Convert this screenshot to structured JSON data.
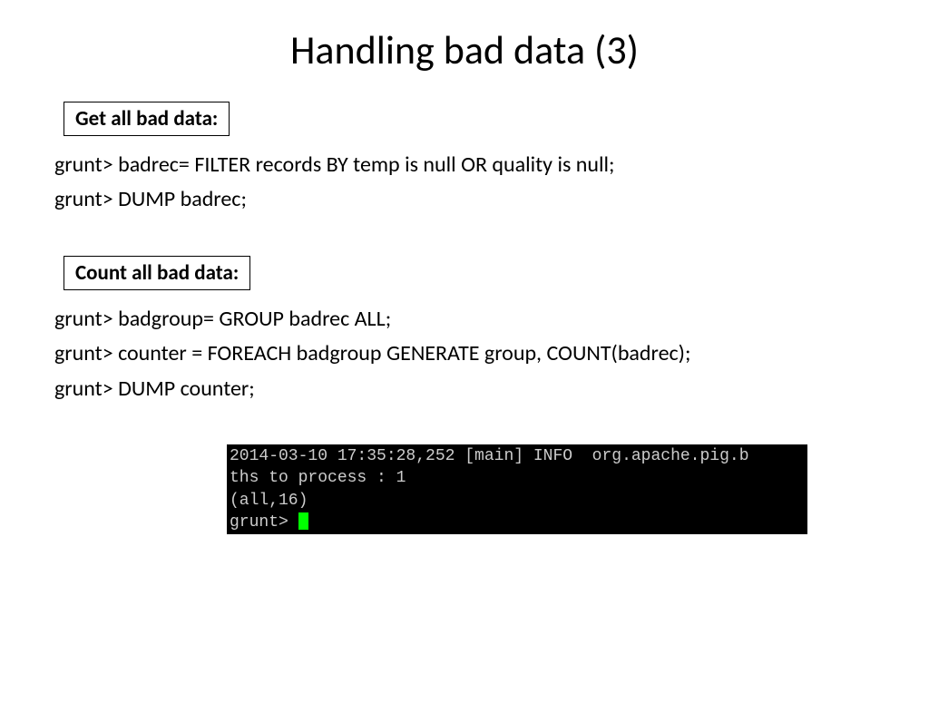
{
  "title": "Handling bad data (3)",
  "section1": {
    "label": "Get all bad data:",
    "line1": "grunt> badrec= FILTER records BY temp is null OR quality is null;",
    "line2": "grunt> DUMP badrec;"
  },
  "section2": {
    "label": "Count all bad data:",
    "line1": "grunt> badgroup= GROUP badrec ALL;",
    "line2": "grunt> counter = FOREACH badgroup GENERATE group, COUNT(badrec);",
    "line3": "grunt> DUMP counter;"
  },
  "terminal": {
    "line1": "2014-03-10 17:35:28,252 [main] INFO  org.apache.pig.b",
    "line2": "ths to process : 1",
    "line3": "(all,16)",
    "prompt": "grunt> "
  }
}
